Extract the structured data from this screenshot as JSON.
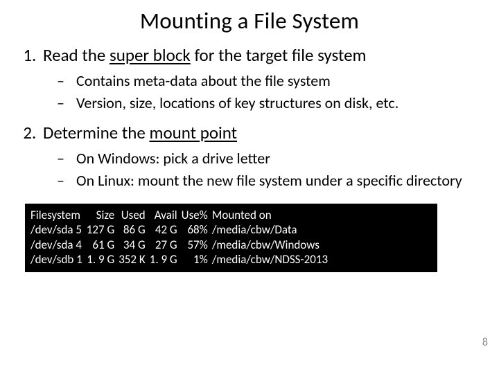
{
  "title": "Mounting a File System",
  "item1": {
    "pre": "Read the ",
    "u": "super block",
    "post": " for the target file system",
    "subs": [
      "Contains meta-data about the file system",
      "Version, size, locations of key structures on disk, etc."
    ]
  },
  "item2": {
    "pre": "Determine the ",
    "u": "mount point",
    "post": "",
    "subs": [
      "On Windows: pick a drive letter",
      "On Linux: mount the new file system under a specific directory"
    ]
  },
  "df": {
    "headers": [
      "Filesystem",
      "Size",
      "Used",
      "Avail",
      "Use%",
      "Mounted on"
    ],
    "rows": [
      [
        "/dev/sda 5",
        "127 G",
        "86 G",
        "42 G",
        "68%",
        "/media/cbw/Data"
      ],
      [
        "/dev/sda 4",
        "61 G",
        "34 G",
        "27 G",
        "57%",
        "/media/cbw/Windows"
      ],
      [
        "/dev/sdb 1",
        "1. 9 G",
        "352 K",
        "1. 9 G",
        "1%",
        "/media/cbw/NDSS-2013"
      ]
    ]
  },
  "pagenum": "8"
}
